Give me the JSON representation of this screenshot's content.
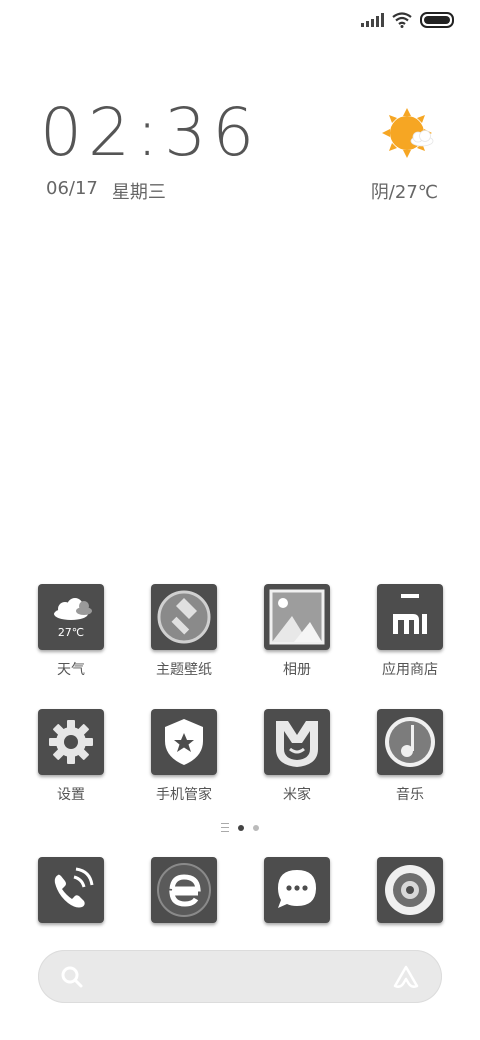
{
  "status_bar": {
    "icons": [
      "signal-icon",
      "wifi-icon",
      "battery-icon"
    ]
  },
  "clock_widget": {
    "time": "02:36",
    "date": "06/17",
    "weekday": "星期三",
    "weather": "阴/27℃",
    "weather_icon": "sun-cloud-icon"
  },
  "apps": [
    {
      "label": "天气",
      "icon": "weather-cloud-icon",
      "icon_text": "27℃"
    },
    {
      "label": "主题壁纸",
      "icon": "brush-icon"
    },
    {
      "label": "相册",
      "icon": "gallery-icon"
    },
    {
      "label": "应用商店",
      "icon": "mi-store-icon"
    },
    {
      "label": "设置",
      "icon": "gear-icon"
    },
    {
      "label": "手机管家",
      "icon": "shield-star-icon"
    },
    {
      "label": "米家",
      "icon": "mijia-icon"
    },
    {
      "label": "音乐",
      "icon": "music-note-icon"
    }
  ],
  "dock": [
    {
      "icon": "phone-icon"
    },
    {
      "icon": "browser-icon"
    },
    {
      "icon": "message-icon"
    },
    {
      "icon": "camera-icon"
    }
  ],
  "page_indicator": {
    "pages": 2,
    "current": 1
  },
  "colors": {
    "tile": "#4d4d4d",
    "accent_sun": "#f6a623",
    "background": "#ffffff"
  }
}
